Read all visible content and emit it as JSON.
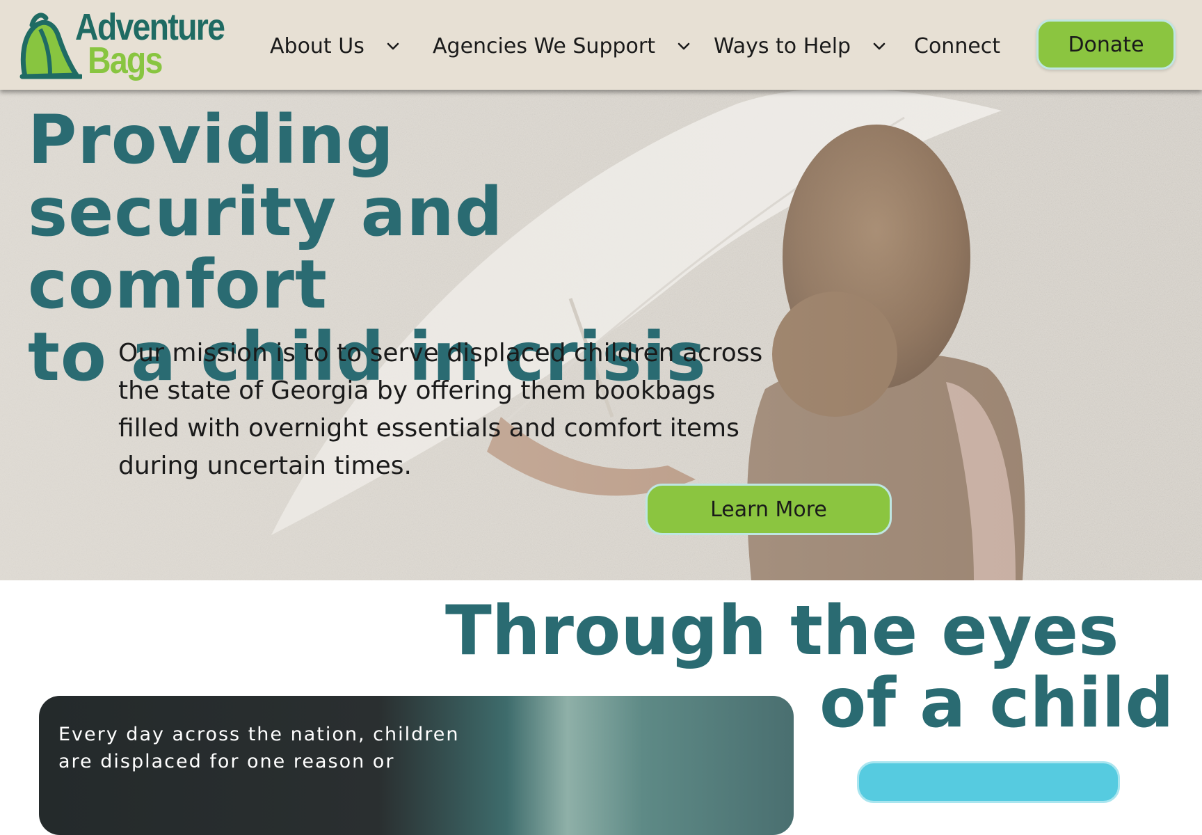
{
  "header": {
    "logo": {
      "line1": "Adventure",
      "line2": "Bags",
      "icon": "backpack-leaf-icon"
    },
    "nav": [
      {
        "label": "About Us",
        "has_dropdown": true
      },
      {
        "label": "Agencies We Support",
        "has_dropdown": true
      },
      {
        "label": "Ways to Help",
        "has_dropdown": true
      },
      {
        "label": "Connect",
        "has_dropdown": false
      }
    ],
    "donate_label": "Donate"
  },
  "hero": {
    "title_lines": [
      "Providing",
      "security and comfort",
      "to a child in crisis"
    ],
    "mission_lines": [
      "Our mission is to to serve displaced children across",
      "the state of Georgia by offering them bookbags",
      "filled with overnight essentials and comfort items",
      "during uncertain times."
    ],
    "button_label": "Learn More"
  },
  "section2": {
    "title_line1": "Through the eyes",
    "title_line2": "of a child",
    "card_text_lines": [
      "Every day across the nation, children",
      "are displaced for one reason or"
    ]
  },
  "colors": {
    "brand_teal": "#2a6b72",
    "brand_green": "#8bc540",
    "header_bg": "#e7e0d4",
    "accent_cyan": "#56cbe0"
  }
}
